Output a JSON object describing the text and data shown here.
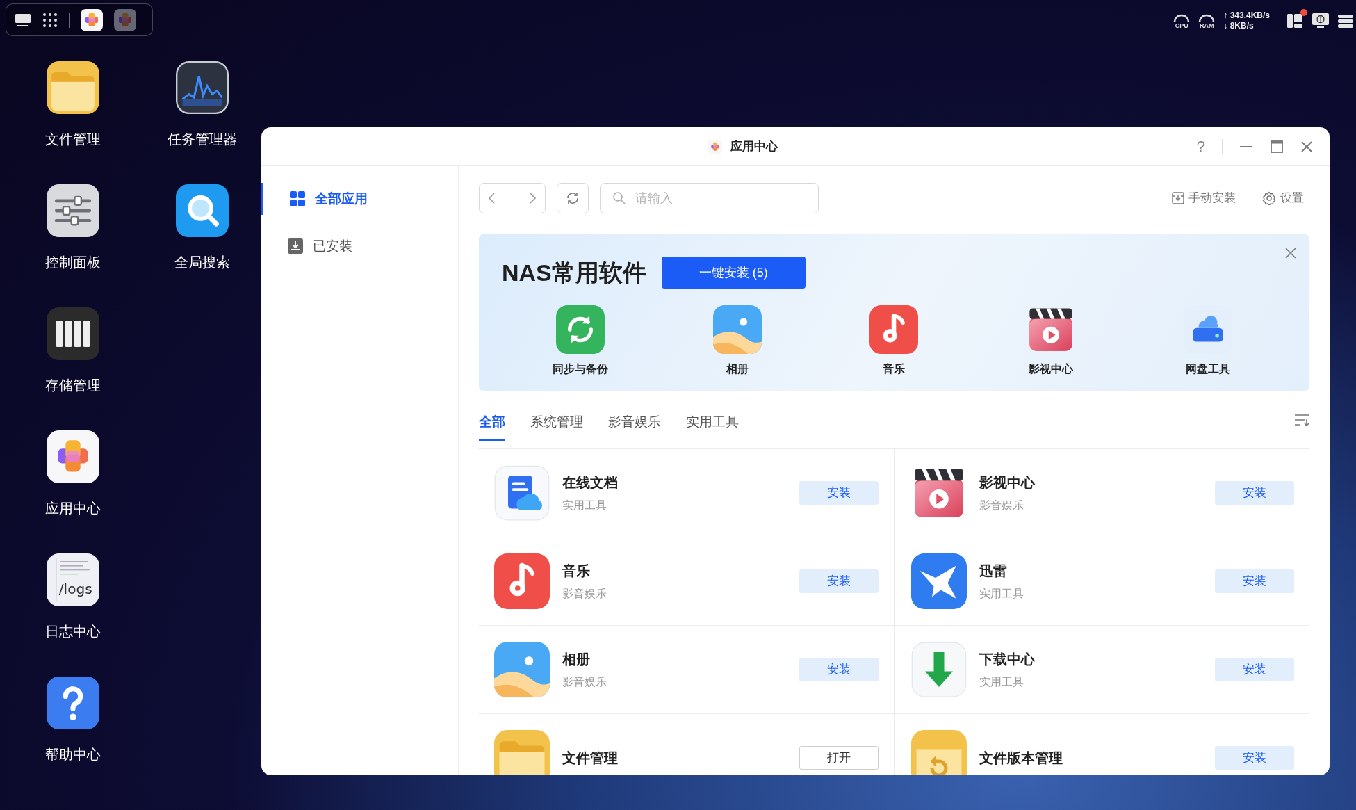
{
  "status": {
    "cpu": "CPU",
    "ram": "RAM",
    "upload": "↑ 343.4KB/s",
    "download": "↓ 8KB/s",
    "notification": true
  },
  "desktop_icons": [
    {
      "label": "文件管理",
      "kind": "files"
    },
    {
      "label": "任务管理器",
      "kind": "taskmgr"
    },
    {
      "label": "控制面板",
      "kind": "control"
    },
    {
      "label": "全局搜索",
      "kind": "search"
    },
    {
      "label": "存储管理",
      "kind": "storage"
    },
    {
      "label": "应用中心",
      "kind": "appcenter"
    },
    {
      "label": "日志中心",
      "kind": "logs",
      "icon_text": "/logs"
    },
    {
      "label": "帮助中心",
      "kind": "help"
    }
  ],
  "window": {
    "title": "应用中心",
    "controls": [
      "?"
    ]
  },
  "sidebar": {
    "items": [
      {
        "label": "全部应用",
        "kind": "all",
        "selected": true
      },
      {
        "label": "已安装",
        "kind": "installed",
        "selected": false
      }
    ]
  },
  "toolbar": {
    "search": {
      "placeholder": "请输入"
    },
    "actions": [
      {
        "label": "手动安装",
        "kind": "install"
      },
      {
        "label": "设置",
        "kind": "settings"
      }
    ]
  },
  "banner": {
    "title": "NAS常用软件",
    "button": "一键安装 (5)",
    "apps": [
      {
        "label": "同步与备份",
        "kind": "sync"
      },
      {
        "label": "相册",
        "kind": "photos"
      },
      {
        "label": "音乐",
        "kind": "music"
      },
      {
        "label": "影视中心",
        "kind": "video"
      },
      {
        "label": "网盘工具",
        "kind": "netdisk"
      }
    ]
  },
  "tabs": [
    {
      "label": "全部",
      "selected": true
    },
    {
      "label": "系统管理",
      "selected": false
    },
    {
      "label": "影音娱乐",
      "selected": false
    },
    {
      "label": "实用工具",
      "selected": false
    }
  ],
  "apps": [
    {
      "name": "在线文档",
      "category": "实用工具",
      "kind": "docs",
      "button": {
        "label": "安装",
        "kind": "install"
      }
    },
    {
      "name": "影视中心",
      "category": "影音娱乐",
      "kind": "video",
      "button": {
        "label": "安装",
        "kind": "install"
      }
    },
    {
      "name": "音乐",
      "category": "影音娱乐",
      "kind": "music",
      "button": {
        "label": "安装",
        "kind": "install"
      }
    },
    {
      "name": "迅雷",
      "category": "实用工具",
      "kind": "xunlei",
      "button": {
        "label": "安装",
        "kind": "install"
      }
    },
    {
      "name": "相册",
      "category": "影音娱乐",
      "kind": "photos",
      "button": {
        "label": "安装",
        "kind": "install"
      }
    },
    {
      "name": "下载中心",
      "category": "实用工具",
      "kind": "download",
      "button": {
        "label": "安装",
        "kind": "install"
      }
    },
    {
      "name": "文件管理",
      "kind": "files",
      "button": {
        "label": "打开",
        "kind": "open"
      }
    },
    {
      "name": "文件版本管理",
      "kind": "fileversion",
      "button": {
        "label": "安装",
        "kind": "install"
      }
    }
  ]
}
